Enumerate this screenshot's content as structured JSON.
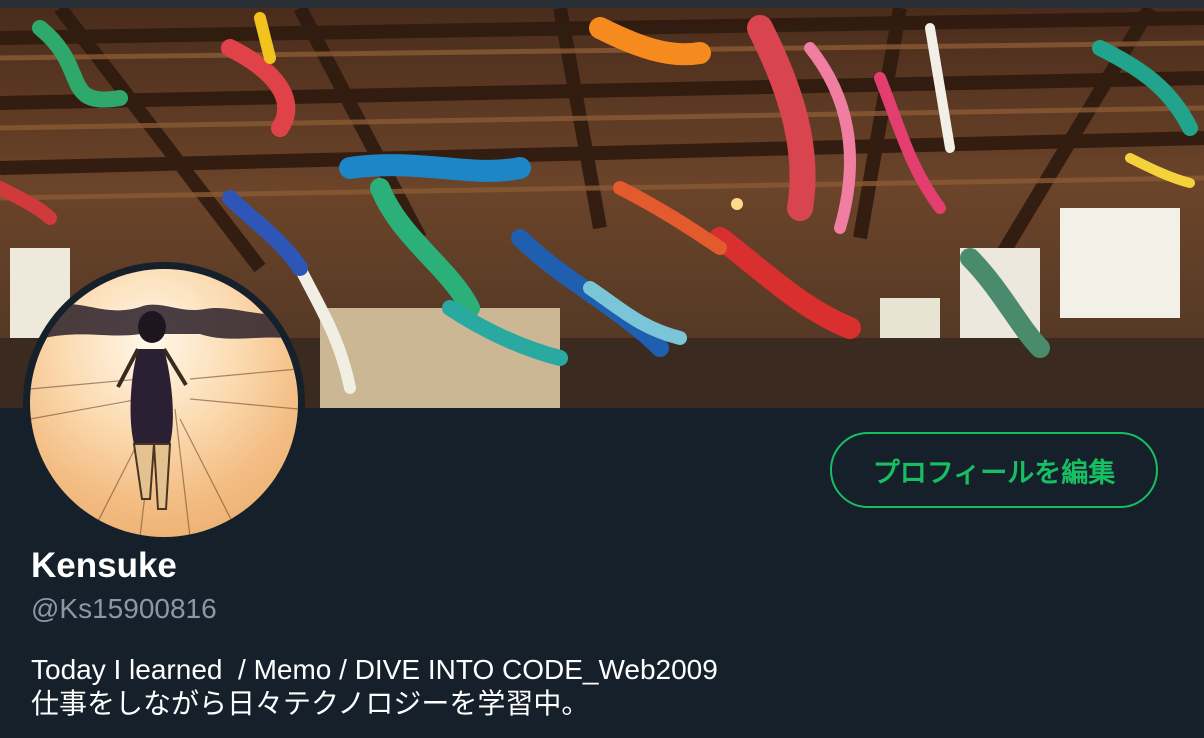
{
  "profile": {
    "name": "Kensuke",
    "handle": "@Ks15900816",
    "bio_line1": "Today I learned  / Memo / DIVE INTO CODE_Web2009",
    "bio_line2": "仕事をしながら日々テクノロジーを学習中。"
  },
  "actions": {
    "edit_profile_label": "プロフィールを編集"
  },
  "colors": {
    "background": "#15202b",
    "accent": "#17bf63",
    "secondary_text": "#8899a6"
  }
}
